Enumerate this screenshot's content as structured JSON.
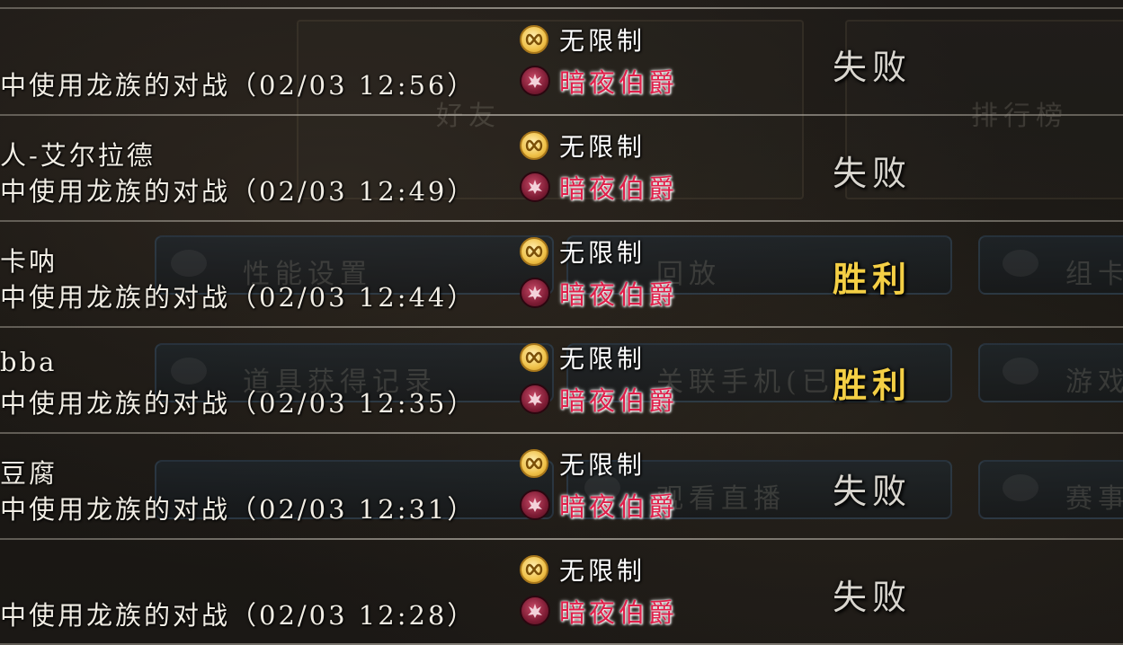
{
  "background": {
    "panels": [
      "好友",
      "排行榜"
    ],
    "buttons": [
      "性能设置",
      "回放",
      "组卡",
      "道具获得记录",
      "关联手机(已",
      "游戏",
      "",
      "观看直播",
      "赛事"
    ]
  },
  "colors": {
    "win": "#f4cf45",
    "lose": "#d9d6cf",
    "class_name": "#e01f4a",
    "text": "#f1ede4"
  },
  "matches": [
    {
      "opponent": "",
      "description": "中使用龙族的对战（02/03 12:56）",
      "format": "无限制",
      "format_icon": "infinity-icon",
      "class_name": "暗夜伯爵",
      "class_icon": "vampire-crest-icon",
      "result": "失败",
      "outcome": "lose"
    },
    {
      "opponent": "人-艾尔拉德",
      "description": "中使用龙族的对战（02/03 12:49）",
      "format": "无限制",
      "format_icon": "infinity-icon",
      "class_name": "暗夜伯爵",
      "class_icon": "vampire-crest-icon",
      "result": "失败",
      "outcome": "lose"
    },
    {
      "opponent": "卡呐",
      "description": "中使用龙族的对战（02/03 12:44）",
      "format": "无限制",
      "format_icon": "infinity-icon",
      "class_name": "暗夜伯爵",
      "class_icon": "vampire-crest-icon",
      "result": "胜利",
      "outcome": "win"
    },
    {
      "opponent": "bba",
      "description": "中使用龙族的对战（02/03 12:35）",
      "format": "无限制",
      "format_icon": "infinity-icon",
      "class_name": "暗夜伯爵",
      "class_icon": "vampire-crest-icon",
      "result": "胜利",
      "outcome": "win"
    },
    {
      "opponent": "豆腐",
      "description": "中使用龙族的对战（02/03 12:31）",
      "format": "无限制",
      "format_icon": "infinity-icon",
      "class_name": "暗夜伯爵",
      "class_icon": "vampire-crest-icon",
      "result": "失败",
      "outcome": "lose"
    },
    {
      "opponent": "",
      "description": "中使用龙族的对战（02/03 12:28）",
      "format": "无限制",
      "format_icon": "infinity-icon",
      "class_name": "暗夜伯爵",
      "class_icon": "vampire-crest-icon",
      "result": "失败",
      "outcome": "lose"
    }
  ]
}
